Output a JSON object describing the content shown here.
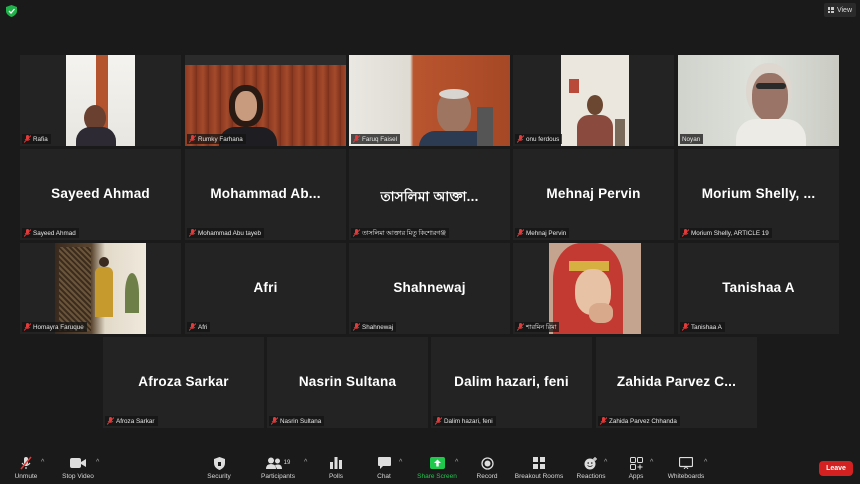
{
  "top": {
    "view_label": "View"
  },
  "row1": [
    {
      "name": "Rafia"
    },
    {
      "name": "Rumky Farhana"
    },
    {
      "name": "Faruq Faisel"
    },
    {
      "name": "onu ferdous"
    },
    {
      "name": "Noyan"
    }
  ],
  "row2": [
    {
      "display": "Sayeed Ahmad",
      "name": "Sayeed Ahmad"
    },
    {
      "display": "Mohammad  Ab...",
      "name": "Mohammad Abu tayeb"
    },
    {
      "display": "তাসলিমা আক্তা...",
      "name": "তাসলিমা আক্তার মিতু কিশোরগঞ্জ"
    },
    {
      "display": "Mehnaj Pervin",
      "name": "Mehnaj Pervin"
    },
    {
      "display": "Morium Shelly, ...",
      "name": "Morium Shelly, ARTICLE 19"
    }
  ],
  "row3": [
    {
      "name": "Homayra Faruque"
    },
    {
      "display": "Afri",
      "name": "Afri"
    },
    {
      "display": "Shahnewaj",
      "name": "Shahnewaj"
    },
    {
      "name": "শারমিন রিমা"
    },
    {
      "display": "Tanishaa A",
      "name": "Tanishaa A"
    }
  ],
  "row4": [
    {
      "display": "Afroza Sarkar",
      "name": "Afroza Sarkar"
    },
    {
      "display": "Nasrin Sultana",
      "name": "Nasrin Sultana"
    },
    {
      "display": "Dalim hazari, feni",
      "name": "Dalim hazari, feni"
    },
    {
      "display": "Zahida Parvez C...",
      "name": "Zahida Parvez Chhanda"
    }
  ],
  "toolbar": {
    "unmute": "Unmute",
    "stop_video": "Stop Video",
    "security": "Security",
    "participants": "Participants",
    "participants_count": "19",
    "polls": "Polls",
    "chat": "Chat",
    "share_screen": "Share Screen",
    "record": "Record",
    "breakout": "Breakout Rooms",
    "reactions": "Reactions",
    "apps": "Apps",
    "whiteboards": "Whiteboards",
    "leave": "Leave"
  },
  "colors": {
    "share_green": "#1ec94c",
    "leave_red": "#d32020",
    "active_speaker": "#c6d44a",
    "muted_red": "#e23b3b"
  }
}
